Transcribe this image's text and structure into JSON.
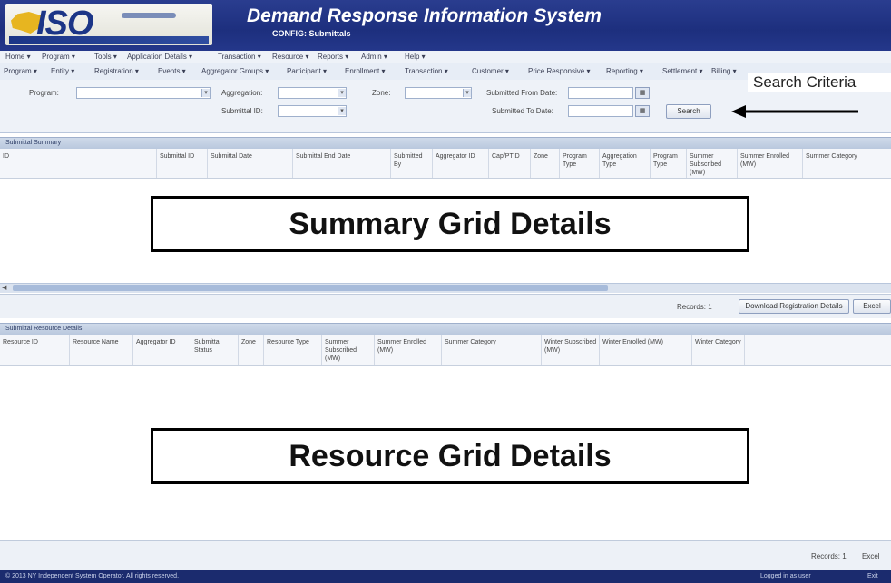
{
  "header": {
    "logo_text": "ISO",
    "title": "Demand Response Information System",
    "subtitle": "CONFIG: Submittals"
  },
  "menu_row1": [
    "Home ▾",
    "Program ▾",
    "Tools ▾",
    "Application Details ▾",
    "Transaction ▾",
    "Resource ▾",
    "Reports ▾",
    "Admin ▾",
    "Help ▾"
  ],
  "menu_row2": [
    "Program ▾",
    "Entity ▾",
    "Registration ▾",
    "Events ▾",
    "Aggregator Groups ▾",
    "Participant ▾",
    "Enrollment ▾",
    "Transaction ▾",
    "Customer ▾",
    "Price Responsive ▾",
    "Reporting ▾",
    "Settlement ▾",
    "Billing ▾"
  ],
  "search": {
    "heading": "Search Criteria",
    "program_label": "Program:",
    "aggregation_label": "Aggregation:",
    "zone_label": "Zone:",
    "submitted_from_label": "Submitted From Date:",
    "submittal_id_label": "Submittal ID:",
    "submitted_to_label": "Submitted To Date:",
    "search_button": "Search",
    "calendar_icon": "▦"
  },
  "summary_section": {
    "bar_label": "Submittal Summary",
    "columns": [
      "ID",
      "Submittal ID",
      "Submittal Date",
      "Submittal End Date",
      "Submitted By",
      "Aggregator ID",
      "Cap/PTID",
      "Zone",
      "Program Type",
      "Aggregation Type",
      "Program Type",
      "Summer Subscribed (MW)",
      "Summer Enrolled (MW)",
      "Summer Category"
    ],
    "overlay_label": "Summary Grid Details",
    "record_count": "Records: 1",
    "download_button": "Download Registration Details",
    "extra_button": "Excel"
  },
  "resource_section": {
    "bar_label": "Submittal Resource Details",
    "columns": [
      "Resource ID",
      "Resource Name",
      "Aggregator ID",
      "Submittal Status",
      "Zone",
      "Resource Type",
      "Summer Subscribed (MW)",
      "Summer Enrolled (MW)",
      "Summer Category",
      "Winter Subscribed (MW)",
      "Winter Enrolled (MW)",
      "Winter Category"
    ],
    "overlay_label": "Resource Grid Details",
    "record_count": "Records: 1",
    "export_button": "Excel"
  },
  "status_bar": {
    "copyright": "© 2013 NY Independent System Operator. All rights reserved.",
    "right_text": "Logged in as user",
    "far_right": "Exit"
  }
}
